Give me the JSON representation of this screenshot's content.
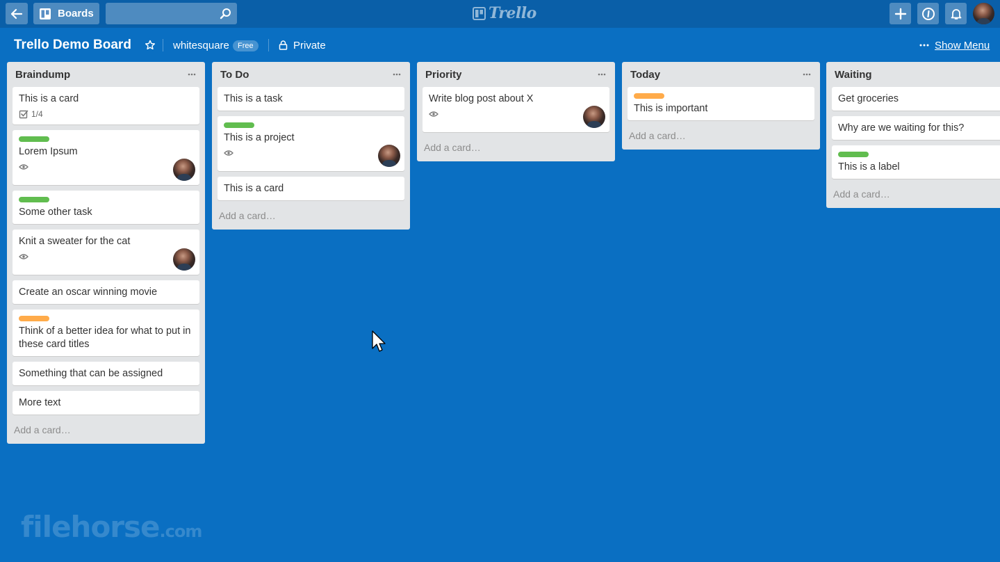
{
  "header": {
    "boards_label": "Boards",
    "search_value": "",
    "logo_text": "Trello"
  },
  "board": {
    "title": "Trello Demo Board",
    "team": "whitesquare",
    "plan_badge": "Free",
    "privacy": "Private",
    "show_menu": "Show Menu"
  },
  "colors": {
    "background": "#0a6fc2",
    "header": "#0a5fa8",
    "label_green": "#61bd4f",
    "label_orange": "#ffab4a"
  },
  "lists": [
    {
      "title": "Braindump",
      "cards": [
        {
          "title": "This is a card",
          "checklist": "1/4"
        },
        {
          "title": "Lorem Ipsum",
          "label": "green",
          "watching": true,
          "member": true
        },
        {
          "title": "Some other task",
          "label": "green"
        },
        {
          "title": "Knit a sweater for the cat",
          "watching": true,
          "member": true
        },
        {
          "title": "Create an oscar winning movie"
        },
        {
          "title": "Think of a better idea for what to put in these card titles",
          "label": "orange"
        },
        {
          "title": "Something that can be assigned"
        },
        {
          "title": "More text"
        }
      ],
      "add_card": "Add a card…"
    },
    {
      "title": "To Do",
      "cards": [
        {
          "title": "This is a task"
        },
        {
          "title": "This is a project",
          "label": "green",
          "watching": true,
          "member": true
        },
        {
          "title": "This is a card"
        }
      ],
      "add_card": "Add a card…"
    },
    {
      "title": "Priority",
      "cards": [
        {
          "title": "Write blog post about X",
          "watching": true,
          "member": true
        }
      ],
      "add_card": "Add a card…"
    },
    {
      "title": "Today",
      "cards": [
        {
          "title": "This is important",
          "label": "orange"
        }
      ],
      "add_card": "Add a card…"
    },
    {
      "title": "Waiting",
      "cards": [
        {
          "title": "Get groceries"
        },
        {
          "title": "Why are we waiting for this?"
        },
        {
          "title": "This is a label",
          "label": "green"
        }
      ],
      "add_card": "Add a card…"
    }
  ],
  "watermark": {
    "main": "filehorse",
    "suffix": ".com"
  }
}
